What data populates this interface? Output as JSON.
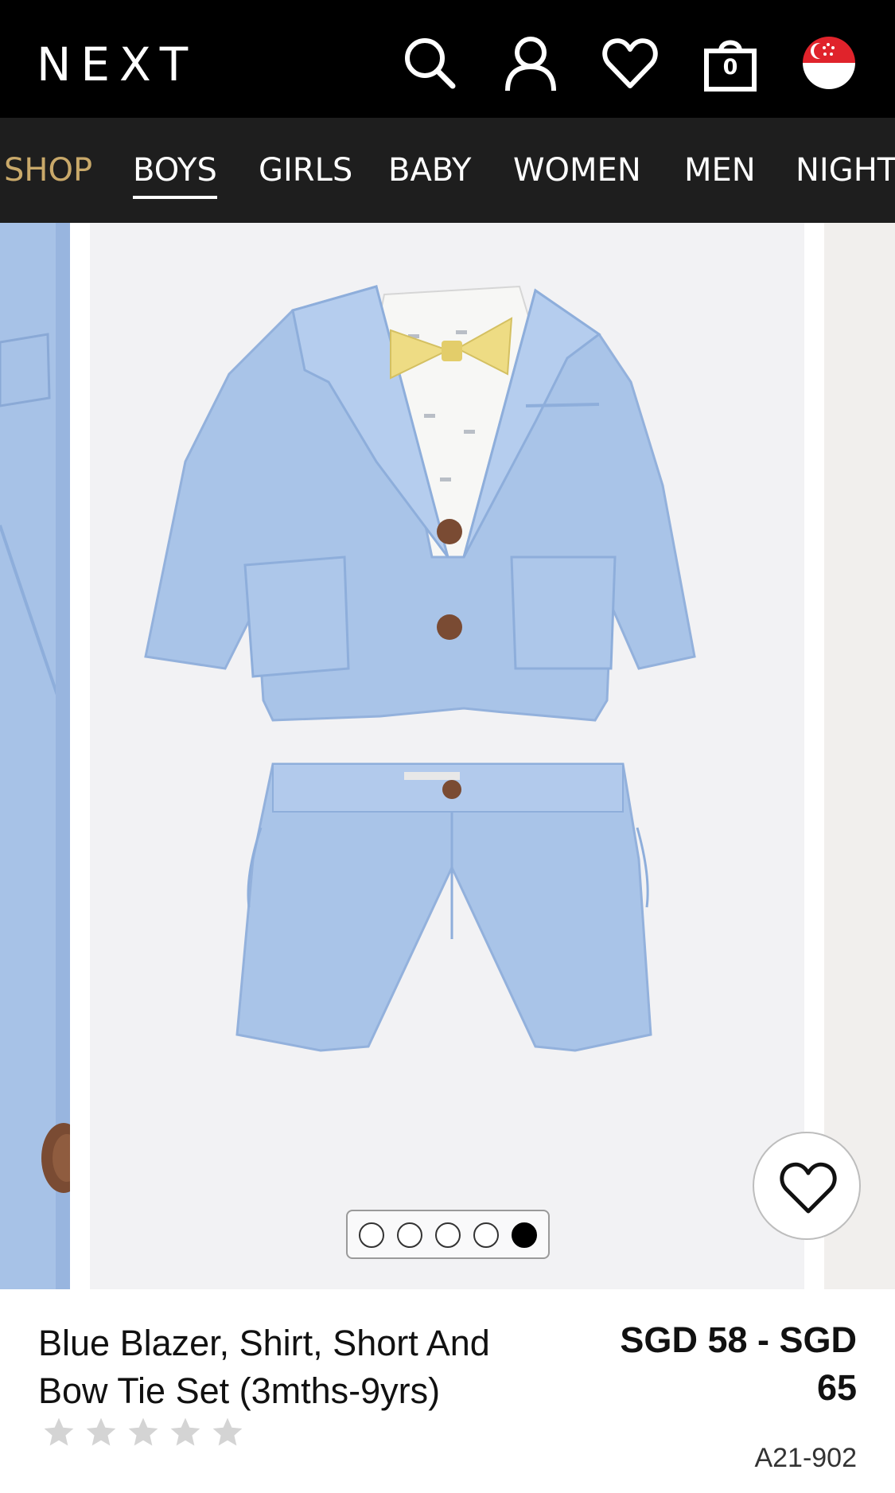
{
  "header": {
    "logo": "NEXT",
    "icons": [
      "search-icon",
      "account-icon",
      "heart-icon",
      "bag-icon",
      "country-flag-icon"
    ],
    "bag_count": "0"
  },
  "nav": {
    "items": [
      "SHOP",
      "BOYS",
      "GIRLS",
      "BABY",
      "WOMEN",
      "MEN",
      "NIGHT"
    ],
    "active": "BOYS"
  },
  "gallery": {
    "total_images": 5,
    "active_index": 5
  },
  "product": {
    "title": "Blue Blazer, Shirt, Short And Bow Tie Set (3mths-9yrs)",
    "price_line1": "SGD 58 - SGD",
    "price_line2": "65",
    "rating_stars": 5,
    "rating_filled": 0,
    "code": "A21-902"
  },
  "colors": {
    "header_bg": "#000000",
    "nav_bg": "#1e1e1e",
    "shop_accent": "#c9a96a",
    "fabric_blue": "#a9c4e8",
    "bow_tie_yellow": "#eedc84",
    "star_grey": "#d4d4d4"
  }
}
